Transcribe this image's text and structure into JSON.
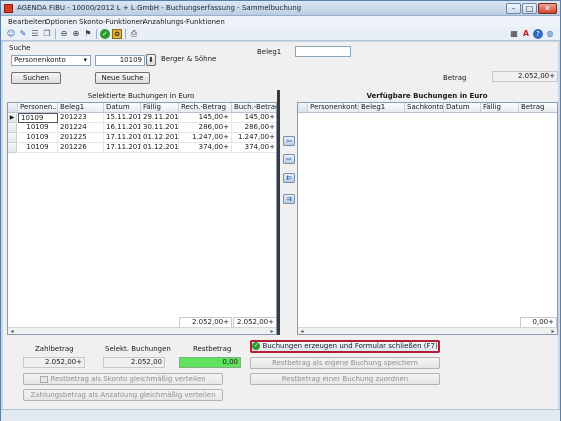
{
  "window": {
    "title": "AGENDA FIBU - 10000/2012 L + L GmbH - Buchungserfassung - Sammelbuchung"
  },
  "menu": [
    "Bearbeiten",
    "Optionen",
    "Skonto-Funktionen",
    "Anzahlungs-Funktionen"
  ],
  "search": {
    "label": "Suche",
    "type_value": "Personenkonto",
    "account_value": "10109",
    "account_name": "Berger & Söhne",
    "search_button": "Suchen",
    "new_search_button": "Neue Suche"
  },
  "beleg": {
    "label": "Beleg1",
    "value": ""
  },
  "betrag": {
    "label": "Betrag",
    "value": "2.052,00+"
  },
  "selected": {
    "title": "Selektierte Buchungen in Euro",
    "columns": [
      "Personen...",
      "Beleg1",
      "Datum",
      "Fällig",
      "Rech.-Betrag",
      "Buch.-Betrag"
    ],
    "rows": [
      [
        "10109",
        "201223",
        "15.11.2012",
        "29.11.2012",
        "145,00+",
        "145,00+"
      ],
      [
        "10109",
        "201224",
        "16.11.2012",
        "30.11.2012",
        "286,00+",
        "286,00+"
      ],
      [
        "10109",
        "201225",
        "17.11.2012",
        "01.12.2012",
        "1.247,00+",
        "1.247,00+"
      ],
      [
        "10109",
        "201226",
        "17.11.2012",
        "01.12.2012",
        "374,00+",
        "374,00+"
      ]
    ],
    "sum_rech": "2.052,00+",
    "sum_buch": "2.052,00+"
  },
  "available": {
    "title": "Verfügbare Buchungen in Euro",
    "columns": [
      "Personenkonto",
      "Beleg1",
      "Sachkonto",
      "Datum",
      "Fällig",
      "Betrag"
    ],
    "sum": "0,00+"
  },
  "summary": {
    "zahlbetrag_label": "Zahlbetrag",
    "zahlbetrag_value": "2.052,00+",
    "selekt_label": "Selekt. Buchungen",
    "selekt_value": "2.052,00",
    "rest_label": "Restbetrag",
    "rest_value": "0,00"
  },
  "buttons": {
    "create": "Buchungen erzeugen und Formular schließen (F7)",
    "rest_own": "Restbetrag als eigene Buchung speichern",
    "rest_assign": "Restbetrag einer Buchung zuordnen",
    "rest_skonto": "Restbetrag als Skonto gleichmäßig verteilen",
    "zahl_anzahlung": "Zahlungsbetrag als Anzahlung gleichmäßig verteilen"
  },
  "colors": {
    "accent_red": "#b21f35",
    "rest_green": "#5fe35f",
    "title_bg": "#c9d7e6"
  },
  "icons": {
    "toolbar": [
      "person-icon",
      "person-edit-icon",
      "list-icon",
      "copy-icon",
      "zoom-out-icon",
      "zoom-in-icon",
      "bookmark-icon",
      "check-icon",
      "save-icon",
      "print-icon"
    ],
    "right": [
      "calculator-icon",
      "agenda-logo-icon",
      "help-icon",
      "globe-icon"
    ],
    "transfer": [
      "move-left-icon",
      "move-right-icon",
      "move-all-left-icon",
      "move-all-right-icon"
    ]
  }
}
